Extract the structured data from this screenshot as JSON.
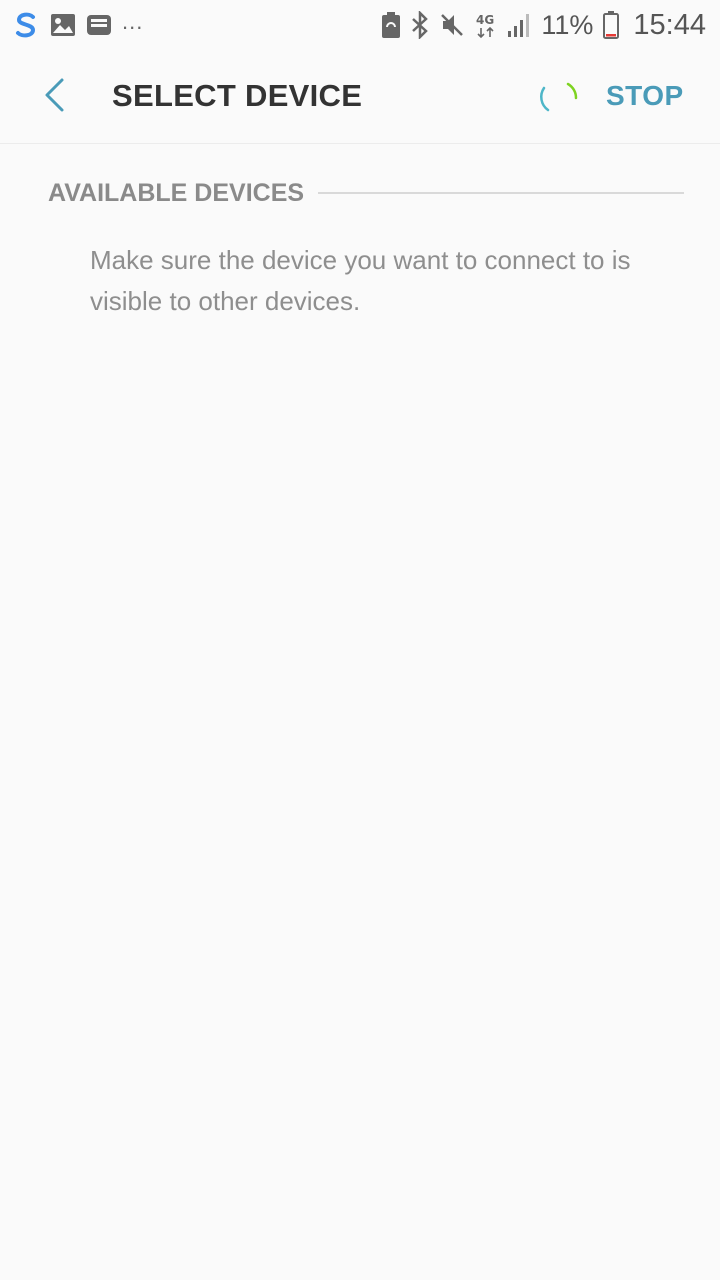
{
  "status_bar": {
    "left_icons": [
      "s-app-icon",
      "image-icon",
      "inbox-icon"
    ],
    "overflow": "...",
    "right_icons": [
      "battery-saver-icon",
      "bluetooth-icon",
      "mute-icon",
      "4g-icon",
      "signal-icon"
    ],
    "network_label": "4G",
    "battery": "11%",
    "time": "15:44"
  },
  "app_bar": {
    "title": "SELECT DEVICE",
    "stop_label": "STOP"
  },
  "section": {
    "title": "AVAILABLE DEVICES",
    "hint": "Make sure the device you want to connect to is visible to other devices."
  },
  "colors": {
    "accent": "#4a9bb8",
    "spinner_a": "#4db6c8",
    "spinner_b": "#7ed321",
    "background": "#fafafa"
  }
}
